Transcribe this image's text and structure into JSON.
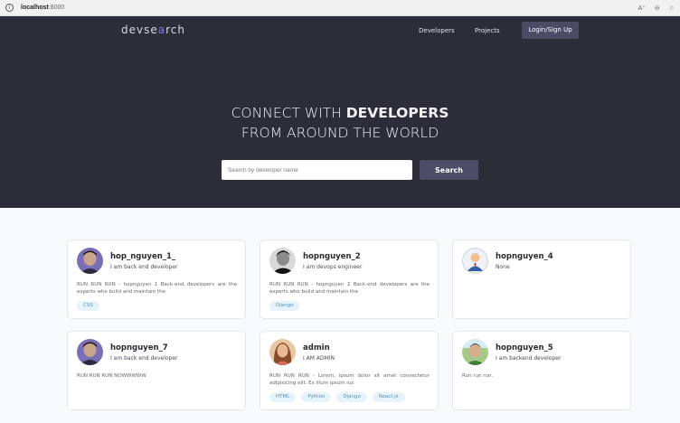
{
  "browser": {
    "host": "localhost",
    "port": ":8000"
  },
  "nav": {
    "logo_pre": "devse",
    "logo_o": "a",
    "logo_post": "rch",
    "developers": "Developers",
    "projects": "Projects",
    "login": "Login/Sign Up"
  },
  "hero": {
    "line1_pre": "CONNECT WITH ",
    "line1_strong": "DEVELOPERS",
    "line2": "FROM AROUND THE WORLD",
    "search_placeholder": "Search by developer name",
    "search_button": "Search"
  },
  "developers": [
    {
      "name": "hop_nguyen_1_",
      "role": "I am back end developer",
      "bio": "RUN RUN RUN - hopnguyen 1 Back-end developers are the experts who build and maintain the",
      "tags": [
        "CSS"
      ]
    },
    {
      "name": "hopnguyen_2",
      "role": "I am devops engineer",
      "bio": "RUN RUN RUN - hopnguyen 2 Back-end developers are the experts who build and maintain the",
      "tags": [
        "Django"
      ]
    },
    {
      "name": "hopnguyen_4",
      "role": "None",
      "bio": "",
      "tags": []
    },
    {
      "name": "hopnguyen_7",
      "role": "I am back end developer",
      "bio": "RUN RUN RUN NOWWWWW",
      "tags": []
    },
    {
      "name": "admin",
      "role": "I AM ADMIN",
      "bio": "RUN RUN RUN - Lorem, ipsum dolor sit amet consectetur adipisicing elit. Ex illum ipsum ius",
      "tags": [
        "HTML",
        "Python",
        "Django",
        "React.js"
      ]
    },
    {
      "name": "hopnguyen_5",
      "role": "I am backend developer",
      "bio": "Run run run.",
      "tags": []
    }
  ]
}
